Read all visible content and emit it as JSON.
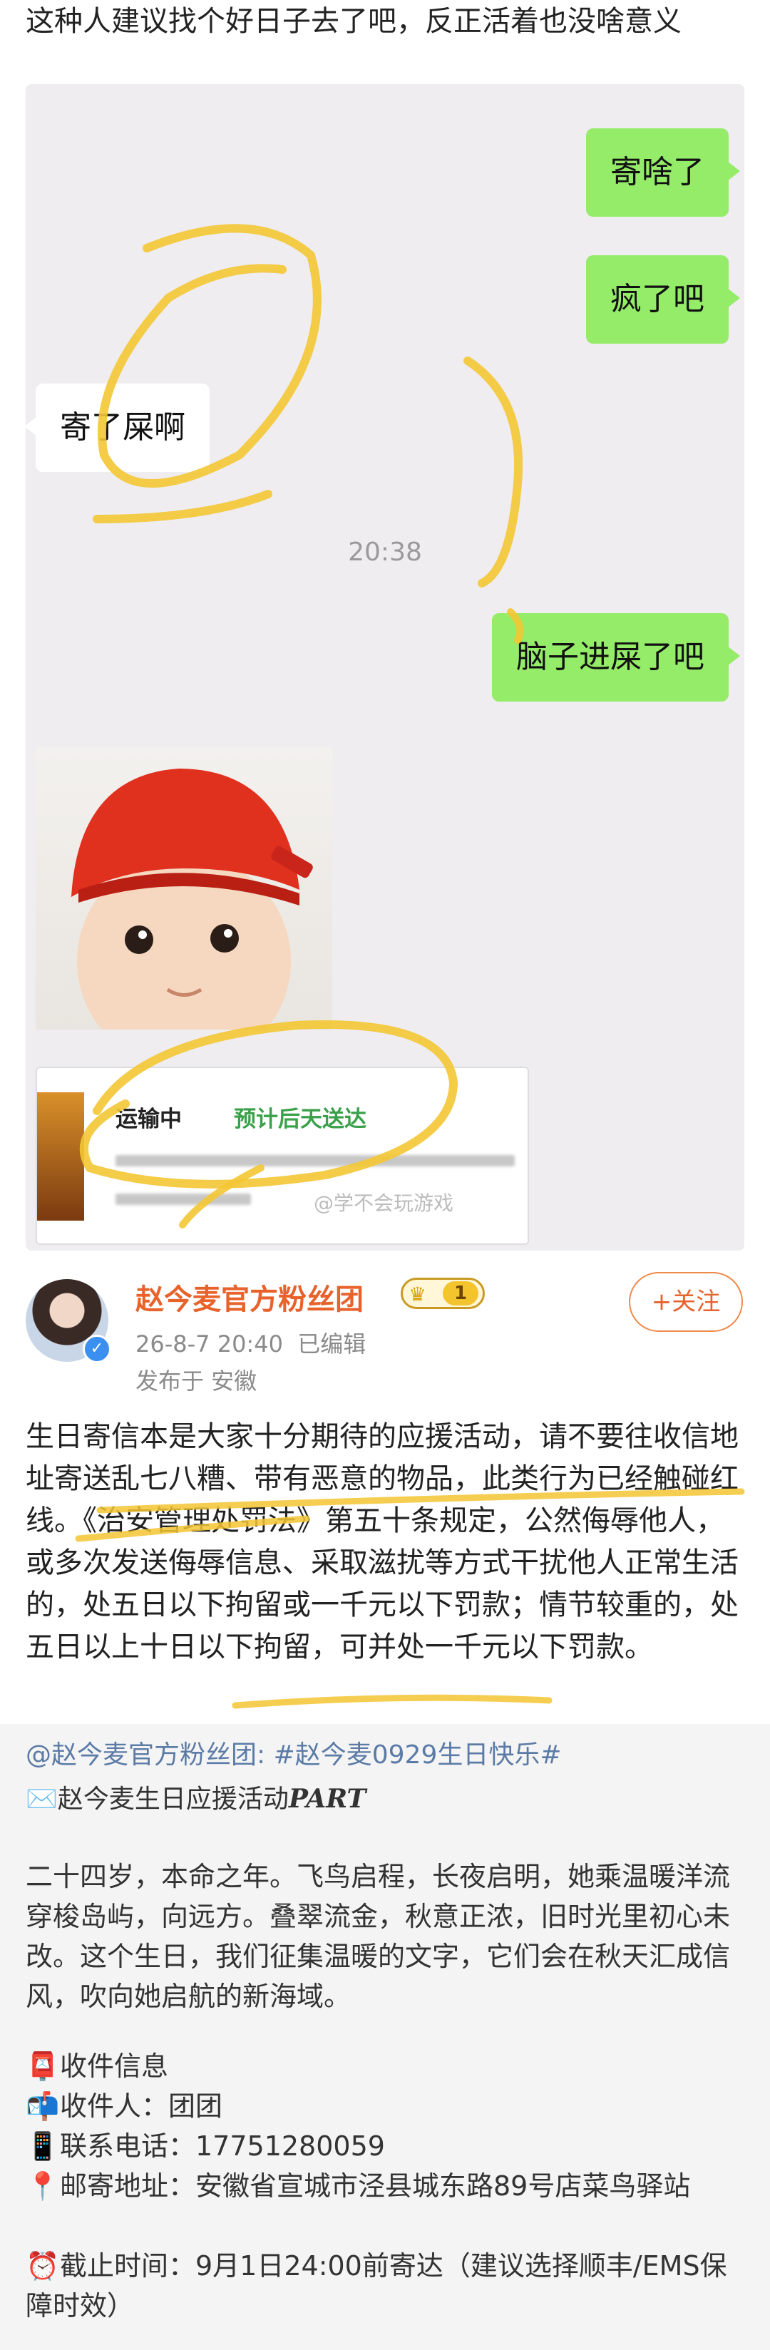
{
  "top_text": "这种人建议找个好日子去了吧，反正活着也没啥意义",
  "chat": {
    "bubble_1": "寄啥了",
    "bubble_2": "疯了吧",
    "bubble_3": "寄了屎啊",
    "time": "20:38",
    "bubble_4": "脑子进屎了吧",
    "shipping_status": "运输中",
    "shipping_eta": "预计后天送达",
    "watermark": "@学不会玩游戏"
  },
  "post": {
    "author": "赵今麦官方粉丝团",
    "badge_level": "1",
    "date": "26-8-7 20:40",
    "edited": "已编辑",
    "location": "发布于 安徽",
    "follow_label": "+关注",
    "body": "生日寄信本是大家十分期待的应援活动，请不要往收信地址寄送乱七八糟、带有恶意的物品，此类行为已经触碰红线。《治安管理处罚法》第五十条规定，公然侮辱他人，或多次发送侮辱信息、采取滋扰等方式干扰他人正常生活的，处五日以下拘留或一千元以下罚款；情节较重的，处五日以上十日以下拘留，可并处一千元以下罚款。"
  },
  "repost": {
    "tags": "@赵今麦官方粉丝团: #赵今麦0929生日快乐#",
    "part_prefix": "✉️赵今麦生日应援活动",
    "part_em": "PART",
    "intro": "二十四岁，本命之年。飞鸟启程，长夜启明，她乘温暖洋流穿梭岛屿，向远方。叠翠流金，秋意正浓，旧时光里初心未改。这个生日，我们征集温暖的文字，它们会在秋天汇成信风，吹向她启航的新海域。",
    "rows": [
      {
        "icon": "📮",
        "text": "收件信息"
      },
      {
        "icon": "📬",
        "text": "收件人：团团"
      },
      {
        "icon": "📱",
        "text": "联系电话：17751280059"
      },
      {
        "icon": "📍",
        "text": "邮寄地址：安徽省宣城市泾县城东路89号店菜鸟驿站"
      },
      {
        "icon": "⏰",
        "text": "截止时间：9月1日24:00前寄达（建议选择顺丰/EMS保障时效）"
      }
    ]
  },
  "colors": {
    "green_bubble": "#95ec69",
    "author_orange": "#e8632c",
    "link_blue": "#5b7ba6",
    "highlight_yellow": "#f3c633"
  }
}
